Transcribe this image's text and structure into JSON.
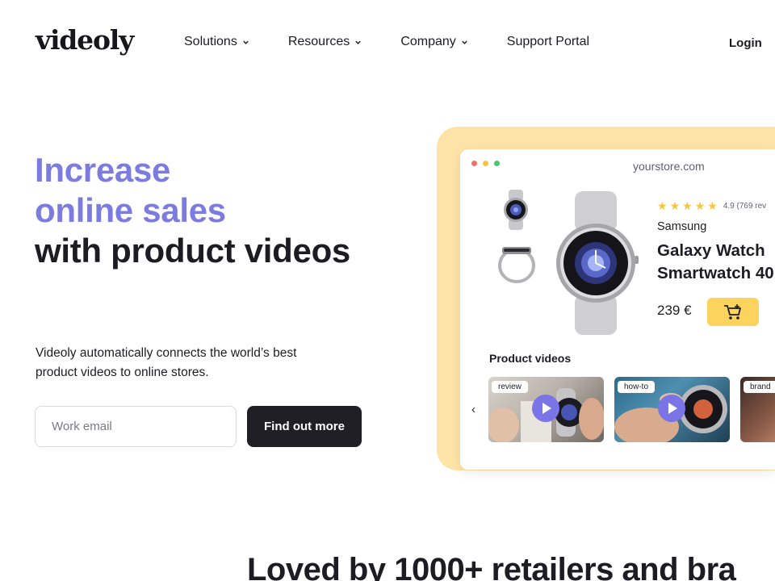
{
  "header": {
    "logo": "videoly",
    "nav": [
      {
        "label": "Solutions",
        "dropdown": true
      },
      {
        "label": "Resources",
        "dropdown": true
      },
      {
        "label": "Company",
        "dropdown": true
      },
      {
        "label": "Support Portal",
        "dropdown": false
      }
    ],
    "login": "Login"
  },
  "hero": {
    "line1": "Increase",
    "line2": "online sales",
    "line3": "with product videos",
    "subtext": "Videoly automatically connects the world’s best product videos to online stores.",
    "email_placeholder": "Work email",
    "cta": "Find out more"
  },
  "mockup": {
    "url": "yourstore.com",
    "dot_colors": [
      "#f1726a",
      "#f7c43d",
      "#47c56f"
    ],
    "rating": "4.9 (769 rev",
    "stars": 5,
    "brand": "Samsung",
    "product_line1": "Galaxy Watch",
    "product_line2": "Smartwatch 40",
    "price": "239 €",
    "cart_icon": "cart-icon",
    "videos_title": "Product videos",
    "videos": [
      {
        "tag": "review"
      },
      {
        "tag": "how-to"
      },
      {
        "tag": "brand"
      }
    ]
  },
  "colors": {
    "accent": "#7b7be0",
    "mockup_bg": "#fde3a6",
    "cart_button": "#fcd35c",
    "cta_bg": "#211f26",
    "play_button": "#7b74e6"
  },
  "section": {
    "loved": "Loved by 1000+ retailers and bra"
  }
}
